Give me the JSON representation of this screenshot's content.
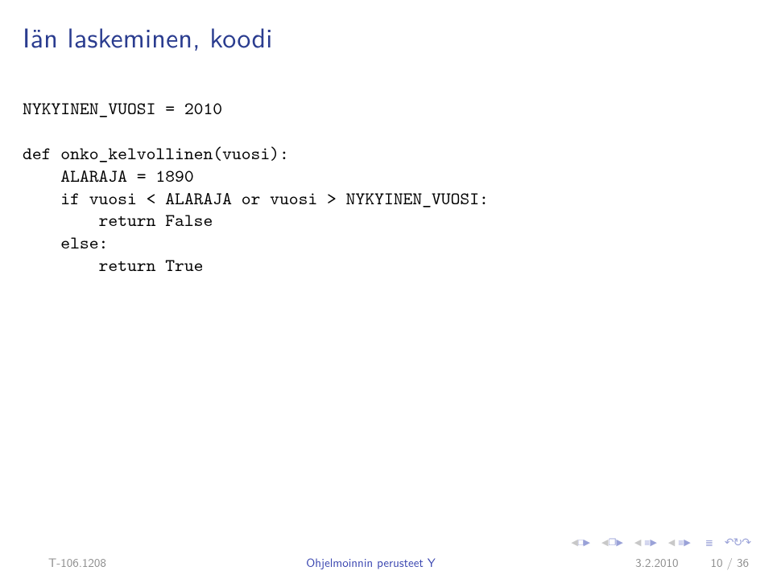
{
  "title": "Iän laskeminen, koodi",
  "code": {
    "l1": "NYKYINEN_VUOSI = 2010",
    "l2": "",
    "l3": "def onko_kelvollinen(vuosi):",
    "l4": "    ALARAJA = 1890",
    "l5": "    if vuosi < ALARAJA or vuosi > NYKYINEN_VUOSI:",
    "l6": "        return False",
    "l7": "    else:",
    "l8": "        return True"
  },
  "footer": {
    "left": "T-106.1208",
    "center": "Ohjelmoinnin perusteet Y",
    "date": "3.2.2010",
    "page": "10 / 36"
  },
  "nav": {
    "tri_left": "◀",
    "tri_right": "▶",
    "box": "□",
    "layers": "❐",
    "eq_left": "≡",
    "eq_right": "≡",
    "eq_end": "≣",
    "loop": "↻",
    "undo": "↶",
    "redo": "↷"
  }
}
